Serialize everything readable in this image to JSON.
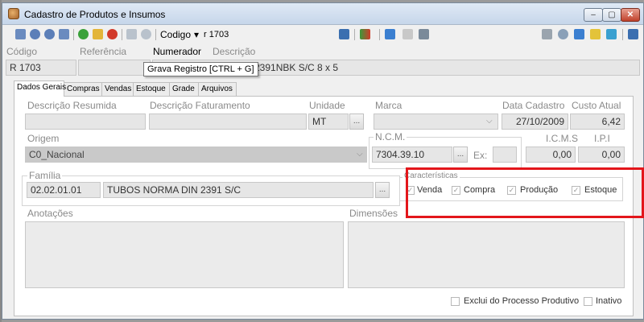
{
  "window": {
    "title": "Cadastro de Produtos e Insumos",
    "minimize_icon": "minimize-icon",
    "maximize_icon": "maximize-icon",
    "close_icon": "close-icon",
    "minimize_glyph": "–",
    "maximize_glyph": "▢",
    "close_glyph": "✕"
  },
  "toolbar": {
    "codigo_label": "Codigo",
    "codigo_arrow": "▾",
    "codigo_value": "r 1703"
  },
  "tooltip": {
    "text": "Grava Registro [CTRL + G]"
  },
  "header_fields": {
    "codigo_label": "Código",
    "codigo_value": "R 1703",
    "referencia_label": "Referência",
    "referencia_value": "",
    "numerador_label": "Numerador",
    "descricao_label": "Descrição",
    "descricao_value": "2391NBK S/C 8 x 5"
  },
  "tabs": [
    {
      "label": "Dados Gerais"
    },
    {
      "label": "Compras"
    },
    {
      "label": "Vendas"
    },
    {
      "label": "Estoque"
    },
    {
      "label": "Grade"
    },
    {
      "label": "Arquivos"
    }
  ],
  "dados_gerais": {
    "descricao_resumida_label": "Descrição Resumida",
    "descricao_resumida_value": "",
    "descricao_faturamento_label": "Descrição Faturamento",
    "descricao_faturamento_value": "",
    "unidade_label": "Unidade",
    "unidade_value": "MT",
    "marca_label": "Marca",
    "marca_value": "",
    "data_cadastro_label": "Data Cadastro",
    "data_cadastro_value": "27/10/2009",
    "custo_atual_label": "Custo Atual",
    "custo_atual_value": "6,42",
    "origem_label": "Origem",
    "origem_value": "C0_Nacional",
    "ncm_label": "N.C.M.",
    "ncm_value": "7304.39.10",
    "ex_label": "Ex:",
    "ex_value": "",
    "icms_label": "I.C.M.S",
    "icms_value": "0,00",
    "ipi_label": "I.P.I",
    "ipi_value": "0,00",
    "familia_label": "Família",
    "familia_code": "02.02.01.01",
    "familia_desc": "TUBOS NORMA DIN 2391 S/C",
    "caracteristicas_label": "Características",
    "caracteristicas": [
      {
        "label": "Venda",
        "checked": true
      },
      {
        "label": "Compra",
        "checked": true
      },
      {
        "label": "Produção",
        "checked": true
      },
      {
        "label": "Estoque",
        "checked": true
      }
    ],
    "anotacoes_label": "Anotações",
    "dimensoes_label": "Dimensões",
    "exclui_label": "Exclui do Processo Produtivo",
    "exclui_checked": false,
    "inativo_label": "Inativo",
    "inativo_checked": false,
    "dots": "...",
    "chevron": "⌵",
    "check_glyph": "✓"
  },
  "colors": {
    "highlight": "#e3161b",
    "titlebar": "#c6d6ea"
  }
}
